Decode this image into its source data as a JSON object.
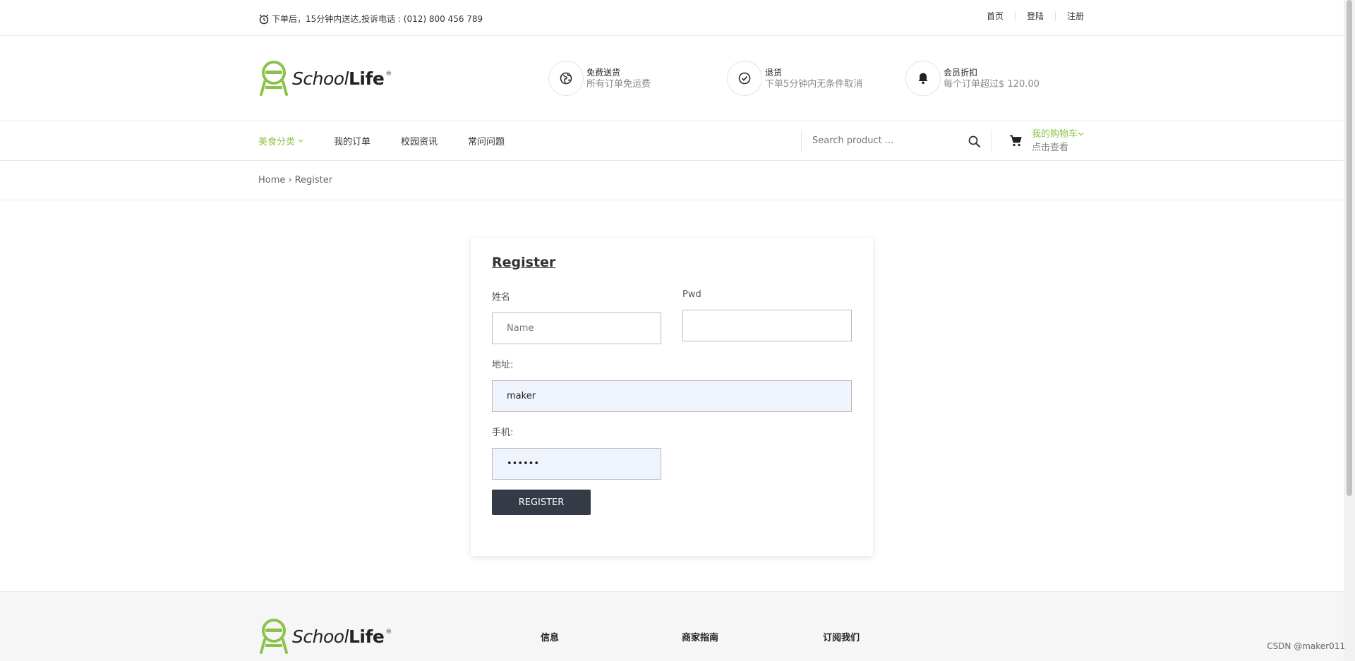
{
  "topbar": {
    "notice": "下单后，15分钟内送达,投诉电话 : (012) 800 456 789",
    "links": [
      "首页",
      "登陆",
      "注册"
    ]
  },
  "logo": {
    "word1": "School",
    "word2": "Life",
    "mark": "®"
  },
  "features": [
    {
      "icon": "globe-icon",
      "title": "免费送货",
      "desc": "所有订单免运费"
    },
    {
      "icon": "check-circle-icon",
      "title": "退货",
      "desc": "下单5分钟内无条件取消"
    },
    {
      "icon": "bell-icon",
      "title": "会员折扣",
      "desc": "每个订单超过$ 120.00"
    }
  ],
  "nav": {
    "items": [
      "美食分类",
      "我的订单",
      "校园资讯",
      "常问问题"
    ],
    "search_placeholder": "Search product ...",
    "cart_title": "我的购物车",
    "cart_sub": "点击查看"
  },
  "breadcrumb": {
    "home": "Home",
    "sep": "›",
    "current": "Register"
  },
  "form": {
    "title": "Register",
    "name_label": "姓名",
    "name_placeholder": "Name",
    "pwd_label": "Pwd",
    "address_label": "地址:",
    "address_value": "maker",
    "phone_label": "手机:",
    "phone_value": "••••••",
    "submit_label": "REGISTER"
  },
  "footer": {
    "cols": [
      "信息",
      "商家指南",
      "订阅我们"
    ]
  },
  "watermark": "CSDN @maker011",
  "colors": {
    "accent": "#8bc34a",
    "button": "#343a46"
  }
}
